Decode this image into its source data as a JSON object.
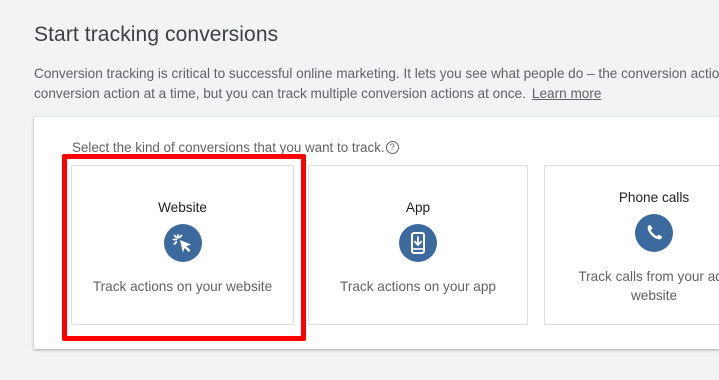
{
  "header": {
    "title": "Start tracking conversions",
    "description_line1": "Conversion tracking is critical to successful online marketing. It lets you see what people do – the conversion actio",
    "description_line2": "conversion action at a time, but you can track multiple conversion actions at once.",
    "learn_more": "Learn more"
  },
  "panel": {
    "prompt": "Select the kind of conversions that you want to track.",
    "help_glyph": "?"
  },
  "cards": [
    {
      "title": "Website",
      "icon": "cursor-click-icon",
      "text": "Track actions on your website"
    },
    {
      "title": "App",
      "icon": "mobile-download-icon",
      "text": "Track actions on your app"
    },
    {
      "title": "Phone calls",
      "icon": "phone-icon",
      "text_line1": "Track calls from your ads",
      "text_line2": "website"
    }
  ],
  "colors": {
    "background": "#f1f3f4",
    "icon_circle": "#3c6a9e",
    "highlight": "#ff0000"
  }
}
